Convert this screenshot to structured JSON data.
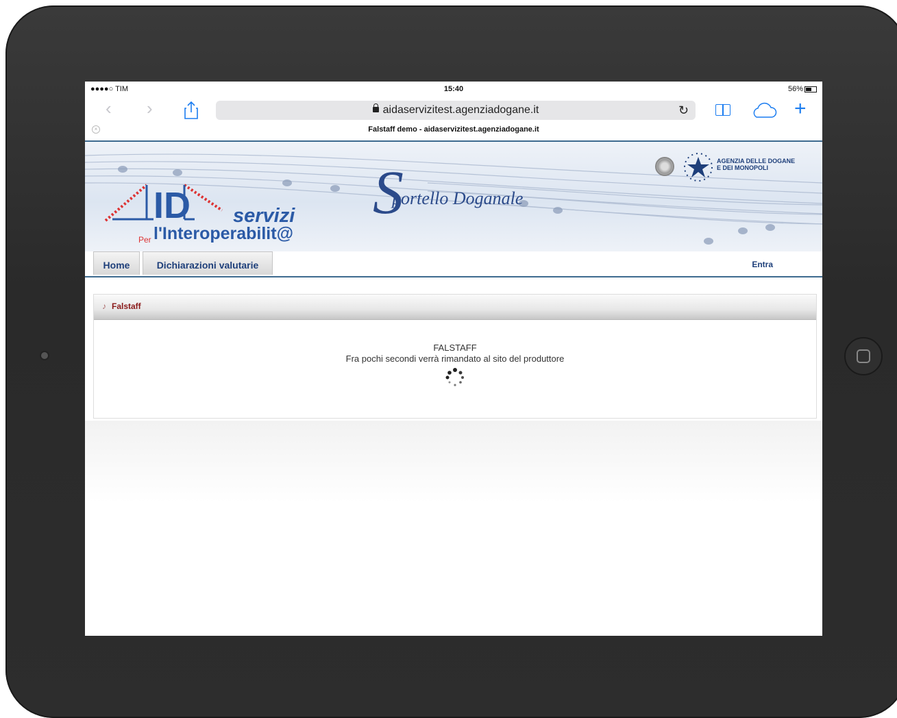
{
  "status_bar": {
    "carrier": "●●●●○ TIM",
    "time": "15:40",
    "battery": "56%"
  },
  "browser": {
    "url": "aidaservizitest.agenziadogane.it",
    "tab_title": "Falstaff demo - aidaservizitest.agenziadogane.it"
  },
  "banner": {
    "logo_id": "ID",
    "servizi": "servizi",
    "per": "Per",
    "interoperabilita": "l'Interoperabilit@",
    "sportello": "portello Doganale",
    "agency_line1": "AGENZIA DELLE DOGANE",
    "agency_line2": "E DEI MONOPOLI"
  },
  "nav": {
    "home": "Home",
    "dichiarazioni": "Dichiarazioni valutarie",
    "entra": "Entra"
  },
  "panel": {
    "title": "Falstaff",
    "message_title": "FALSTAFF",
    "message_text": "Fra pochi secondi verrà rimandato al sito del produttore"
  },
  "colors": {
    "accent": "#1a7cf0",
    "brand_blue": "#2b5aa6",
    "nav_border": "#3d6a8f",
    "panel_title": "#8a1a1a"
  }
}
